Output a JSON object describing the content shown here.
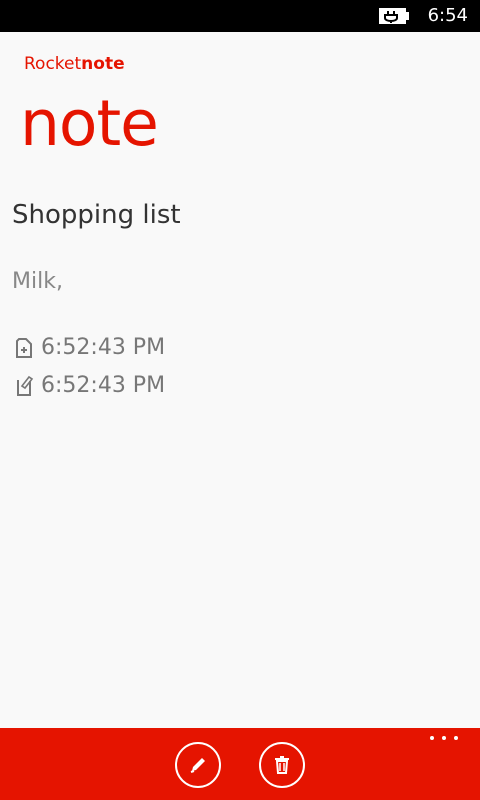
{
  "status_bar": {
    "time": "6:54",
    "battery_icon": "battery-charging-icon"
  },
  "app": {
    "name_prefix": "Rocket",
    "name_suffix": "note",
    "page_title": "note",
    "accent_color": "#e51400"
  },
  "note": {
    "title": "Shopping list",
    "body": "Milk,",
    "created_time": "6:52:43 PM",
    "modified_time": "6:52:43 PM",
    "created_icon": "document-add-icon",
    "modified_icon": "document-edit-icon"
  },
  "app_bar": {
    "buttons": [
      {
        "icon": "edit-icon"
      },
      {
        "icon": "trash-icon"
      }
    ],
    "more_icon": "ellipsis-icon"
  }
}
